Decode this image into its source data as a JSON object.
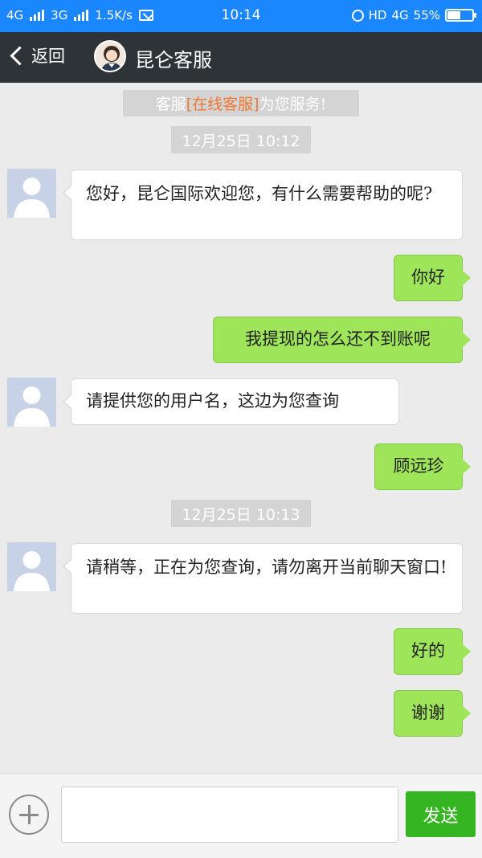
{
  "status_bar": {
    "net1": "4G",
    "net2": "3G",
    "speed": "1.5K/s",
    "time": "10:14",
    "hd": "HD",
    "net3": "4G",
    "battery": "55%"
  },
  "header": {
    "back_label": "返回",
    "title": "昆仑客服"
  },
  "notice": {
    "prefix": "客服",
    "highlight": "[在线客服]",
    "suffix": "为您服务!"
  },
  "timestamps": [
    "12月25日 10:12",
    "12月25日 10:13"
  ],
  "messages": [
    {
      "from": "agent",
      "text": "您好，昆仑国际欢迎您，有什么需要帮助的呢?"
    },
    {
      "from": "user",
      "text": "你好"
    },
    {
      "from": "user",
      "text": "我提现的怎么还不到账呢"
    },
    {
      "from": "agent",
      "text": "请提供您的用户名，这边为您查询"
    },
    {
      "from": "user",
      "text": "顾远珍"
    },
    {
      "from": "agent",
      "text": "请稍等，正在为您查询，请勿离开当前聊天窗口!"
    },
    {
      "from": "user",
      "text": "好的"
    },
    {
      "from": "user",
      "text": "谢谢"
    }
  ],
  "input": {
    "placeholder": "",
    "send_label": "发送"
  },
  "colors": {
    "status_bar": "#1a86ff",
    "nav_bar": "#2e3338",
    "outgoing_bubble": "#9ee55a",
    "send_button": "#34b521",
    "highlight": "#f07732"
  }
}
